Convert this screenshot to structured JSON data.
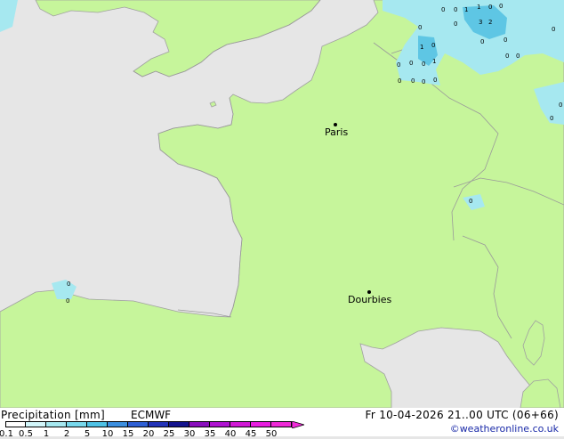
{
  "map": {
    "colors": {
      "sea": "#e6e6e6",
      "land": "#c6f59b",
      "coast": "#a0a0a0",
      "precip_light": "#a6e8f0",
      "precip_mid": "#5ec6e4"
    },
    "cities": [
      {
        "name": "Paris"
      },
      {
        "name": "Dourbies"
      }
    ],
    "precip_values": [
      "0",
      "0",
      "1",
      "1",
      "0",
      "0",
      "3",
      "2",
      "0",
      "0",
      "0",
      "1",
      "0",
      "0",
      "0",
      "1",
      "0",
      "0",
      "0",
      "0",
      "0",
      "0",
      "0",
      "0",
      "0",
      "0",
      "0",
      "0",
      "0",
      "0"
    ]
  },
  "footer": {
    "title": "Precipitation [mm]",
    "model": "ECMWF",
    "valid_time": "Fr 10-04-2026 21..00 UTC (06+66)",
    "copyright": "©weatheronline.co.uk",
    "scale": [
      {
        "label": "0.1",
        "color": "#ffffff"
      },
      {
        "label": "0.5",
        "color": "#d2f6fa"
      },
      {
        "label": "1",
        "color": "#a6e8f0"
      },
      {
        "label": "2",
        "color": "#78d8ec"
      },
      {
        "label": "5",
        "color": "#4fc2e6"
      },
      {
        "label": "10",
        "color": "#3c8fe0"
      },
      {
        "label": "15",
        "color": "#2e5fd4"
      },
      {
        "label": "20",
        "color": "#2233b8"
      },
      {
        "label": "25",
        "color": "#14148e"
      },
      {
        "label": "30",
        "color": "#8a0fbe"
      },
      {
        "label": "35",
        "color": "#b014d2"
      },
      {
        "label": "40",
        "color": "#d21ad6"
      },
      {
        "label": "45",
        "color": "#e81ee0"
      },
      {
        "label": "50",
        "color": "#f02ad8"
      }
    ]
  }
}
